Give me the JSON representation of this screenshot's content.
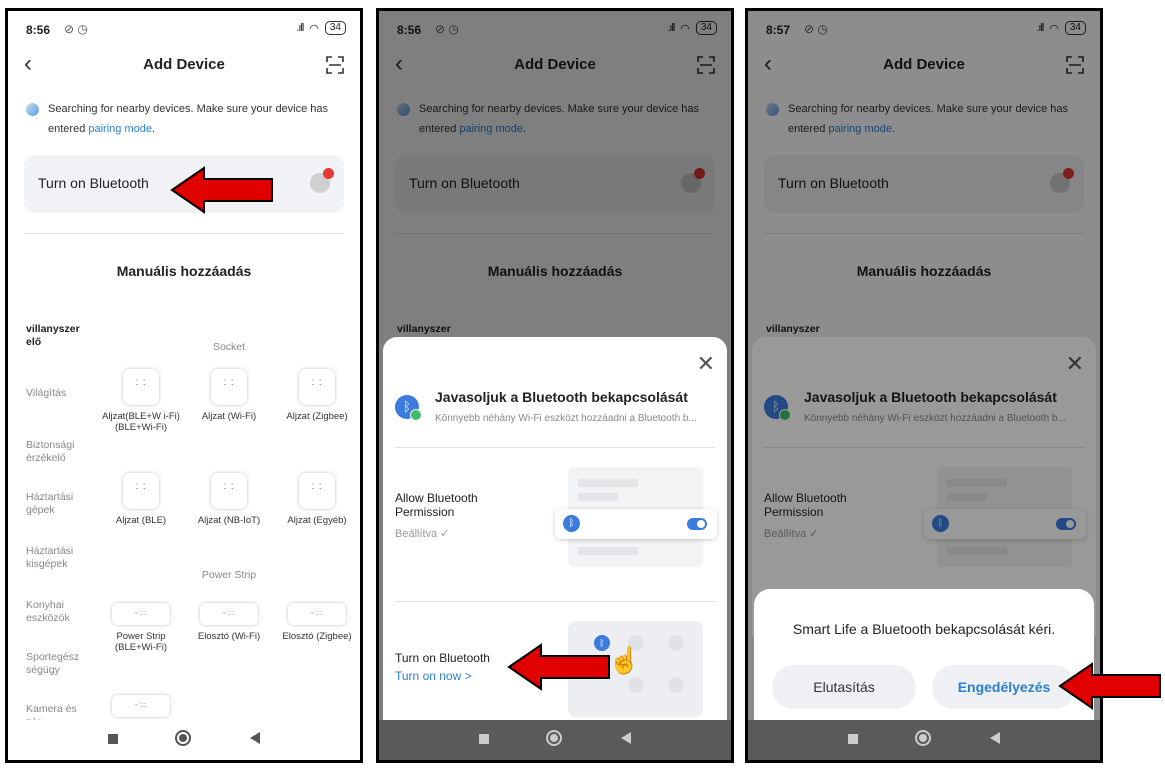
{
  "status": {
    "time_1": "8:56",
    "time_2": "8:56",
    "time_3": "8:57",
    "battery": "34"
  },
  "header": {
    "title": "Add Device"
  },
  "search": {
    "text": "Searching for nearby devices. Make sure your device has entered ",
    "link": "pairing mode",
    "suffix": "."
  },
  "bluetooth_card": {
    "label": "Turn on Bluetooth"
  },
  "manual": {
    "title": "Manuális hozzáadás"
  },
  "sidebar": {
    "items": [
      {
        "label": "villanyszer elő"
      },
      {
        "label": "Világítás"
      },
      {
        "label": "Biztonsági érzékelő"
      },
      {
        "label": "Háztartási gépek"
      },
      {
        "label": "Háztartási kisgépek"
      },
      {
        "label": "Konyhai eszközök"
      },
      {
        "label": "Sportegész ségügy"
      },
      {
        "label": "Kamera és zár"
      }
    ]
  },
  "grid": {
    "section_socket": "Socket",
    "section_strip": "Power Strip",
    "devices": [
      {
        "label": "Aljzat(BLE+W i-Fi) (BLE+Wi-Fi)"
      },
      {
        "label": "Aljzat (Wi-Fi)"
      },
      {
        "label": "Aljzat (Zigbee)"
      },
      {
        "label": "Aljzat (BLE)"
      },
      {
        "label": "Aljzat (NB-IoT)"
      },
      {
        "label": "Aljzat (Egyéb)"
      },
      {
        "label": "Power Strip (BLE+Wi-Fi)"
      },
      {
        "label": "Elosztó (Wi-Fi)"
      },
      {
        "label": "Elosztó (Zigbee)"
      }
    ]
  },
  "sheet": {
    "title": "Javasoljuk a Bluetooth bekapcsolását",
    "subtitle": "Könnyebb néhány Wi-Fi eszközt hozzáadni a Bluetooth b...",
    "permission_label": "Allow Bluetooth Permission",
    "permission_status": "Beállítva ✓",
    "turn_on_label": "Turn on Bluetooth",
    "turn_on_now": "Turn on now >"
  },
  "dialog": {
    "title": "Smart Life a Bluetooth bekapcsolását kéri.",
    "deny": "Elutasítás",
    "allow": "Engedélyezés"
  },
  "colors": {
    "arrow": "#e00000",
    "link": "#2a7fd4",
    "accent": "#3b7be0"
  }
}
